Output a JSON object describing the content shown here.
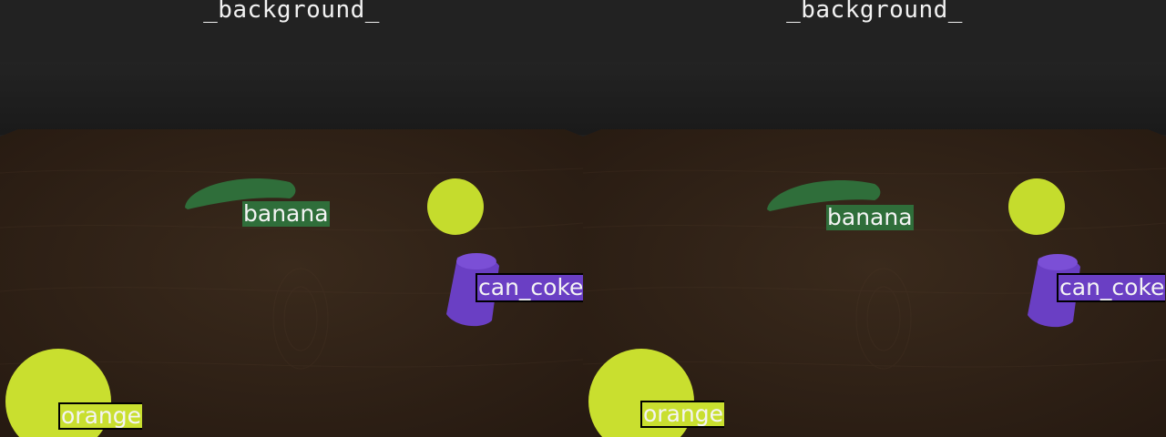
{
  "panels": [
    {
      "background_label": "_background_",
      "labels": {
        "banana": "banana",
        "can": "can_coke",
        "orange": "orange"
      }
    },
    {
      "background_label": "_background_",
      "labels": {
        "banana": "banana",
        "can": "can_coke",
        "orange": "orange"
      }
    }
  ],
  "colors": {
    "background": "#1f1f1f",
    "table": "#2b1d13",
    "banana": "#2f6e3a",
    "can": "#6a3fc4",
    "orange": "#c9df2f",
    "lime": "#c5dc2d"
  }
}
